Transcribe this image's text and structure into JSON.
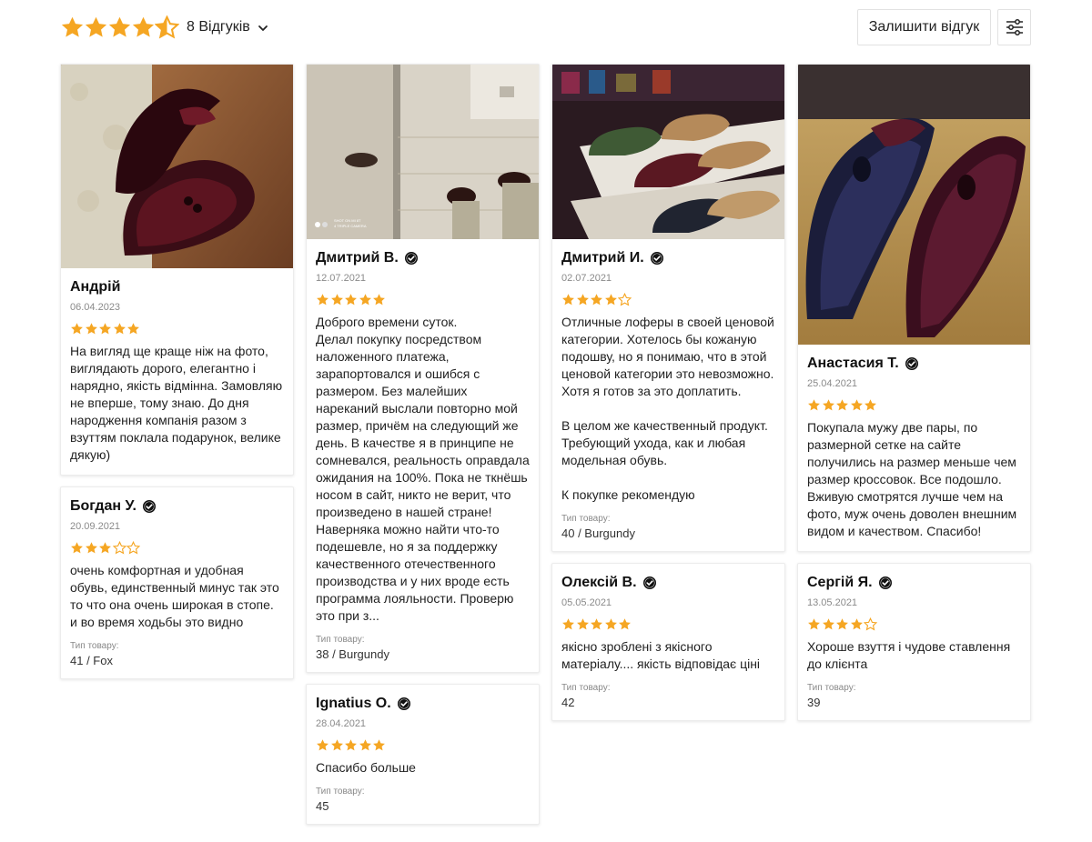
{
  "summary": {
    "rating": 4.5,
    "count_label": "8 Відгуків"
  },
  "actions": {
    "write_review_label": "Залишити відгук"
  },
  "colors": {
    "star": "#f5a623",
    "text": "#222222",
    "muted": "#8a8a8a",
    "border": "#e2e2e2"
  },
  "columns": [
    [
      {
        "name": "Андрій",
        "verified": false,
        "date": "06.04.2023",
        "rating": 5,
        "text": "На вигляд ще краще ніж на фото, виглядають дорого, елегантно і нарядно, якість відмінна. Замовляю не вперше, тому знаю. До дня народження компанія разом з взуттям поклала подарунок, велике дякую)",
        "attr_label": "",
        "attr_value": "",
        "photo": "photo-1"
      },
      {
        "name": "Богдан У.",
        "verified": true,
        "date": "20.09.2021",
        "rating": 3,
        "text": "очень комфортная и удобная обувь, единственный минус так это то что она очень широкая в стопе. и во время ходьбы это видно",
        "attr_label": "Тип товару:",
        "attr_value": "41 / Fox",
        "photo": ""
      }
    ],
    [
      {
        "name": "Дмитрий В.",
        "verified": true,
        "date": "12.07.2021",
        "rating": 5,
        "text": "Доброго времени суток.\nДелал покупку посредством наложенного платежа, зарапортовался и ошибся с размером. Без малейших нареканий выслали повторно мой размер, причём на следующий же день. В качестве я в принципе не сомневался, реальность оправдала ожидания на 100%. Пока не ткнёшь носом в сайт, никто не верит, что произведено в нашей стране! Наверняка можно найти что-то подешевле, но я за поддержку качественного отечественного производства и у них вроде есть программа лояльности. Проверю это при з...",
        "attr_label": "Тип товару:",
        "attr_value": "38 / Burgundy",
        "photo": "photo-2",
        "photo_caption": "SHOT ON MI 8T\n4 TRIPLE CAMERA"
      },
      {
        "name": "Ignatius O.",
        "verified": true,
        "date": "28.04.2021",
        "rating": 5,
        "text": "Спасибо больше",
        "attr_label": "Тип товару:",
        "attr_value": "45",
        "photo": ""
      }
    ],
    [
      {
        "name": "Дмитрий И.",
        "verified": true,
        "date": "02.07.2021",
        "rating": 4,
        "text": "Отличные лоферы в своей ценовой категории. Хотелось бы кожаную подошву, но я понимаю, что в этой ценовой категории это невозможно. Хотя я готов за это доплатить.\n\nВ целом же качественный продукт. Требующий ухода, как и любая модельная обувь.\n\nК покупке рекомендую",
        "attr_label": "Тип товару:",
        "attr_value": "40 / Burgundy",
        "photo": "photo-3"
      },
      {
        "name": "Олексій В.",
        "verified": true,
        "date": "05.05.2021",
        "rating": 5,
        "text": "якісно зроблені з якісного матеріалу.... якість відповідає ціні",
        "attr_label": "Тип товару:",
        "attr_value": "42",
        "photo": ""
      }
    ],
    [
      {
        "name": "Анастасия Т.",
        "verified": true,
        "date": "25.04.2021",
        "rating": 5,
        "text": "Покупала мужу две пары, по размерной сетке на сайте получились на размер меньше чем размер кроссовок. Все подошло. Вживую смотрятся лучше чем на фото, муж очень доволен внешним видом и качеством. Спасибо!",
        "attr_label": "",
        "attr_value": "",
        "photo": "photo-4"
      },
      {
        "name": "Сергій Я.",
        "verified": true,
        "date": "13.05.2021",
        "rating": 4,
        "text": "Хороше взуття і чудове ставлення до клієнта",
        "attr_label": "Тип товару:",
        "attr_value": "39",
        "photo": ""
      }
    ]
  ]
}
